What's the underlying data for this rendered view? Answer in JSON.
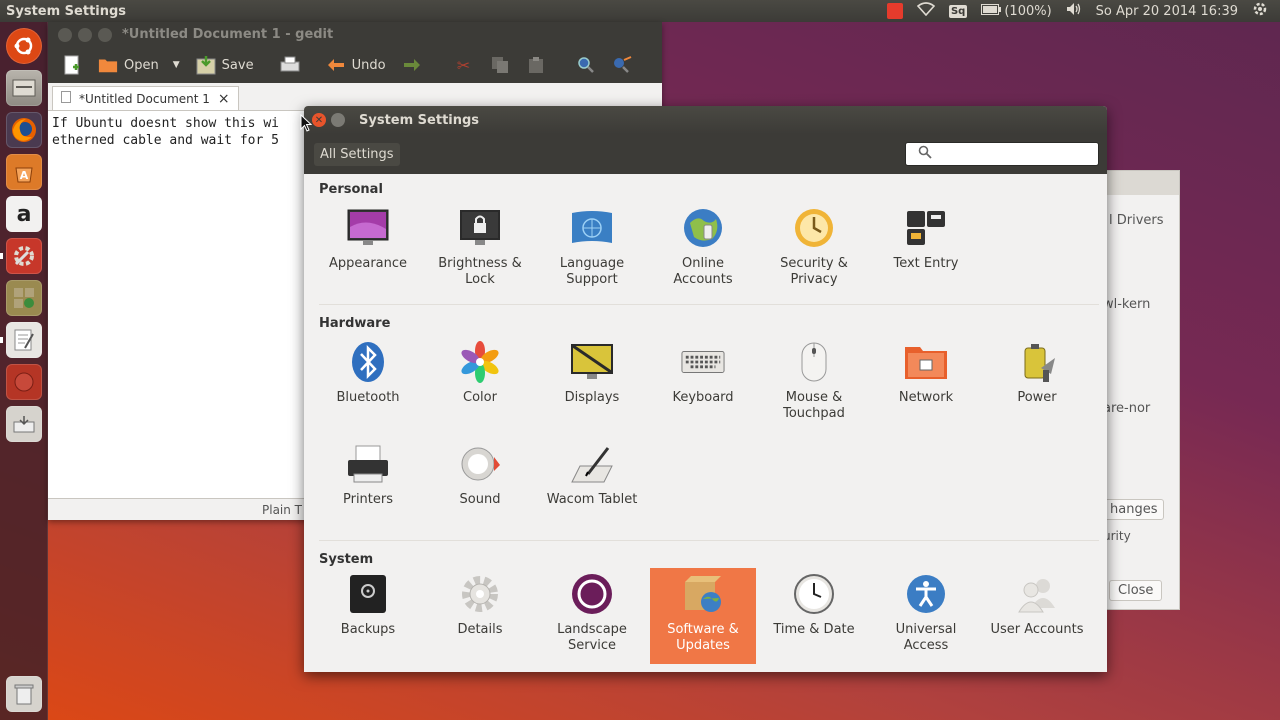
{
  "top_panel": {
    "title": "System Settings",
    "battery": "(100%)",
    "keyboard": "Sq",
    "datetime": "So Apr 20 2014 16:39"
  },
  "launcher": {
    "items": [
      "ubuntu-logo-icon",
      "files-icon",
      "firefox-icon",
      "software-center-icon",
      "amazon-icon",
      "system-settings-icon",
      "workspaces-icon",
      "text-editor-icon",
      "ubuntu-one-icon",
      "removable-drive-icon",
      "trash-icon"
    ],
    "amazon_glyph": "a"
  },
  "gedit": {
    "title": "*Untitled Document 1 - gedit",
    "toolbar": {
      "open": "Open",
      "save": "Save",
      "undo": "Undo"
    },
    "tab_label": "*Untitled Document 1",
    "tab_close": "×",
    "editor_lines": [
      "If Ubuntu doesnt show this wi",
      "etherned cable and wait for 5"
    ],
    "status": "Plain T"
  },
  "background_window": {
    "drivers": "l Drivers",
    "kern": "wl-kern",
    "nor": "are-nor",
    "changes": "hanges",
    "urity": "urity",
    "close": "Close"
  },
  "settings": {
    "title": "System Settings",
    "all_settings": "All Settings",
    "search_placeholder": "",
    "sections": {
      "personal": "Personal",
      "hardware": "Hardware",
      "system": "System"
    },
    "personal_items": [
      "Appearance",
      "Brightness &\nLock",
      "Language\nSupport",
      "Online\nAccounts",
      "Security &\nPrivacy",
      "Text Entry"
    ],
    "hardware_items": [
      "Bluetooth",
      "Color",
      "Displays",
      "Keyboard",
      "Mouse &\nTouchpad",
      "Network",
      "Power",
      "Printers",
      "Sound",
      "Wacom Tablet"
    ],
    "system_items": [
      "Backups",
      "Details",
      "Landscape\nService",
      "Software &\nUpdates",
      "Time & Date",
      "Universal\nAccess",
      "User Accounts"
    ],
    "selected": "Software & Updates",
    "accent_color": "#f07746"
  }
}
